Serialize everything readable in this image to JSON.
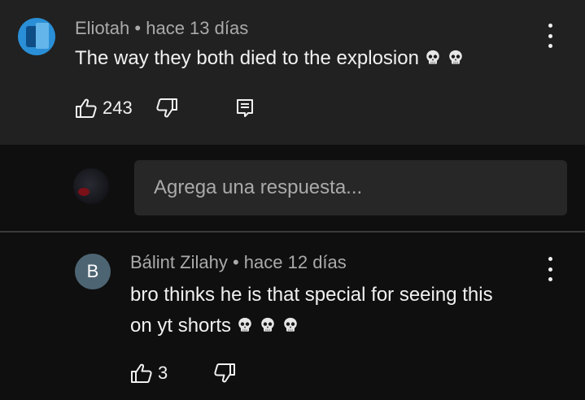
{
  "comment1": {
    "author": "Eliotah",
    "separator": "•",
    "timestamp": "hace 13 días",
    "text": "The way they both died to the explosion",
    "emoji": [
      "skull",
      "skull"
    ],
    "likes": "243",
    "icons": [
      "thumb-up-icon",
      "thumb-down-icon",
      "reply-icon",
      "more-vert-icon"
    ]
  },
  "reply_box": {
    "placeholder": "Agrega una respuesta..."
  },
  "comment2": {
    "avatar_letter": "B",
    "author": "Bálint Zilahy",
    "separator": "•",
    "timestamp": "hace 12 días",
    "text_line1": "bro thinks he is that special for seeing this",
    "text_line2": "on yt shorts",
    "emoji": [
      "skull",
      "skull",
      "skull"
    ],
    "likes": "3",
    "icons": [
      "thumb-up-icon",
      "thumb-down-icon",
      "more-vert-icon"
    ]
  },
  "colors": {
    "background": "#0f0f0f",
    "highlight_background": "#212121",
    "input_background": "#272727",
    "text_primary": "#f1f1f1",
    "text_secondary": "#aaaaaa",
    "avatar_b": "#4d6573"
  }
}
